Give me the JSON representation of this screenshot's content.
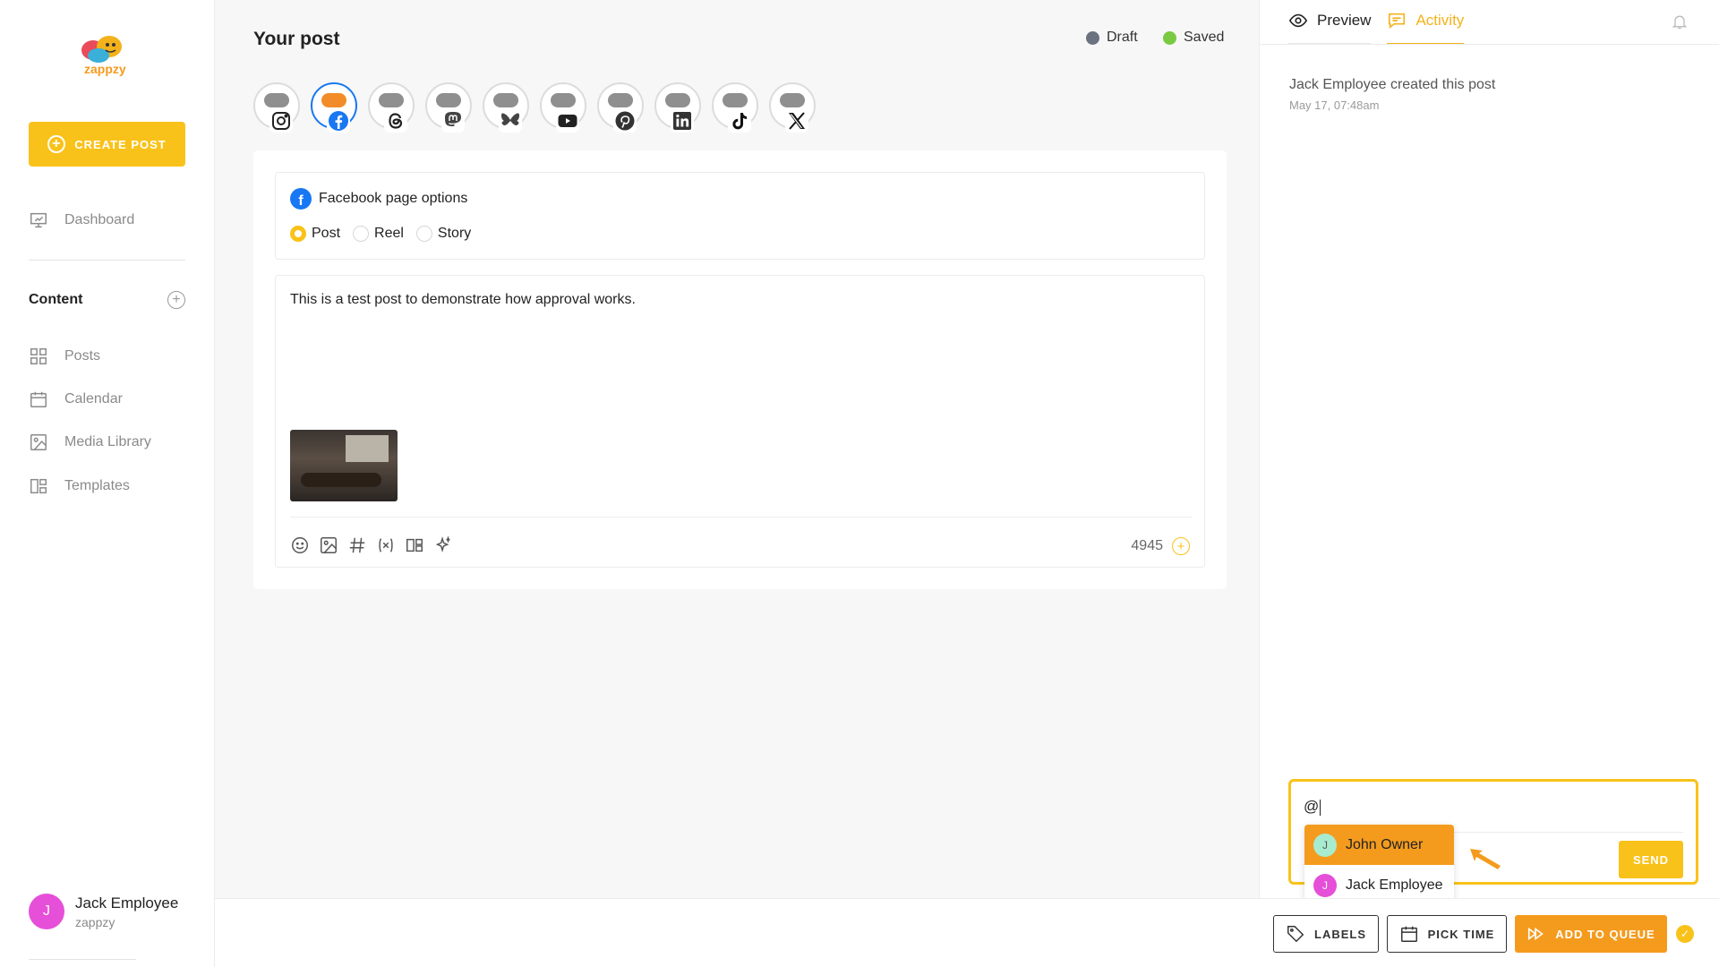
{
  "brand": {
    "name": "zappzy",
    "accent": "#f9c21a",
    "queue_color": "#f49b1e"
  },
  "sidebar": {
    "create_label": "CREATE POST",
    "dashboard": "Dashboard",
    "section_title": "Content",
    "items": [
      {
        "label": "Posts",
        "icon": "grid-icon"
      },
      {
        "label": "Calendar",
        "icon": "calendar-icon"
      },
      {
        "label": "Media Library",
        "icon": "image-icon"
      },
      {
        "label": "Templates",
        "icon": "template-icon"
      }
    ],
    "user": {
      "initial": "J",
      "name": "Jack Employee",
      "org": "zappzy"
    }
  },
  "main": {
    "title": "Your post",
    "status": [
      {
        "label": "Draft",
        "color": "#6b7280"
      },
      {
        "label": "Saved",
        "color": "#7ac943"
      }
    ],
    "accounts": [
      "instagram",
      "facebook",
      "threads",
      "mastodon",
      "bluesky",
      "youtube",
      "pinterest",
      "linkedin",
      "tiktok",
      "x"
    ],
    "fb_options": {
      "title": "Facebook page options",
      "radios": [
        "Post",
        "Reel",
        "Story"
      ],
      "selected": "Post"
    },
    "post_text": "This is a test post to demonstrate how approval works.",
    "char_count": "4945"
  },
  "panel": {
    "tabs": {
      "preview": "Preview",
      "activity": "Activity"
    },
    "activity": {
      "text": "Jack Employee created this post",
      "time": "May 17, 07:48am"
    },
    "comment_value": "@",
    "send_label": "SEND",
    "mentions": [
      {
        "initial": "J",
        "name": "John Owner",
        "color": "#a8ecd0"
      },
      {
        "initial": "J",
        "name": "Jack Employee",
        "color": "#e64fd8"
      }
    ]
  },
  "footer": {
    "labels": "LABELS",
    "pick_time": "PICK TIME",
    "add_to_queue": "ADD TO QUEUE"
  }
}
